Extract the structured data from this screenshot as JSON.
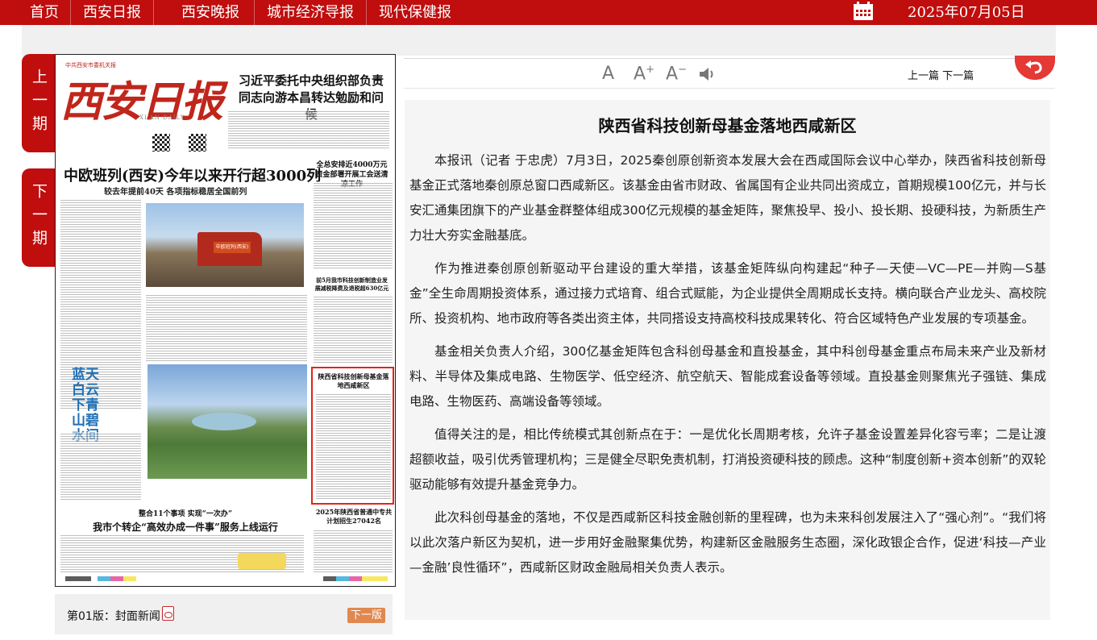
{
  "nav": {
    "items": [
      "首页",
      "西安日报",
      "西安晚报",
      "城市经济导报",
      "现代保健报"
    ],
    "date": "2025年07月05日"
  },
  "period": {
    "prev_label": "上一期",
    "next_label": "下一期"
  },
  "paper_thumb": {
    "top_line": "中共西安市委机关报",
    "logo": "西安日报",
    "logo_sub": "XI'AN DAILY",
    "headline_1": "习近平委托中央组织部负责同志向游本昌转达勉励和问候",
    "headline_main": "中欧班列(西安)今年以来开行超3000列",
    "subhead_main": "较去年提前40天 各项指标稳居全国前列",
    "train_tag": "中欧班列(西安)",
    "right_head_1": "全总安排近4000万元资金部署开展工会送清凉工作",
    "right_head_2": "前5月我市科技创新制造业发展减税降费及退税超630亿元",
    "vertical_title": "蓝天白云下青山碧水间",
    "highlight_title": "陕西省科技创新母基金落地西咸新区",
    "bottom_kicker": "整合11个事项 实现“一次办”",
    "bottom_headline": "我市个转企“高效办成一件事”服务上线运行",
    "bottom_right_head": "2025年陕西省普通中专共计划招生27042名"
  },
  "page_label": "第01版：封面新闻",
  "page_next": "下一版",
  "tools": {
    "font_normal": "A",
    "font_larger": "A",
    "font_smaller": "A",
    "prev_next": "上一篇 下一篇"
  },
  "article": {
    "title": "陕西省科技创新母基金落地西咸新区",
    "paragraphs": [
      "本报讯（记者 于忠虎）7月3日，2025秦创原创新资本发展大会在西咸国际会议中心举办，陕西省科技创新母基金正式落地秦创原总窗口西咸新区。该基金由省市财政、省属国有企业共同出资成立，首期规模100亿元，并与长安汇通集团旗下的产业基金群整体组成300亿元规模的基金矩阵，聚焦投早、投小、投长期、投硬科技，为新质生产力壮大夯实金融基底。",
      "作为推进秦创原创新驱动平台建设的重大举措，该基金矩阵纵向构建起“种子—天使—VC—PE—并购—S基金”全生命周期投资体系，通过接力式培育、组合式赋能，为企业提供全周期成长支持。横向联合产业龙头、高校院所、投资机构、地市政府等各类出资主体，共同搭设支持高校科技成果转化、符合区域特色产业发展的专项基金。",
      "基金相关负责人介绍，300亿基金矩阵包含科创母基金和直投基金，其中科创母基金重点布局未来产业及新材料、半导体及集成电路、生物医学、低空经济、航空航天、智能成套设备等领域。直投基金则聚焦光子强链、集成电路、生物医药、高端设备等领域。",
      "值得关注的是，相比传统模式其创新点在于：一是优化长周期考核，允许子基金设置差异化容亏率；二是让渡超额收益，吸引优秀管理机构；三是健全尽职免责机制，打消投资硬科技的顾虑。这种“制度创新+资本创新”的双轮驱动能够有效提升基金竞争力。",
      "此次科创母基金的落地，不仅是西咸新区科技金融创新的里程碑，也为未来科创发展注入了“强心剂”。“我们将以此次落户新区为契机，进一步用好金融聚集优势，构建新区金融服务生态圈，深化政银企合作，促进‘科技—产业—金融’良性循环”，西咸新区财政金融局相关负责人表示。"
    ]
  },
  "colors": {
    "brand_red": "#c00d0d",
    "accent_orange": "#e0884f",
    "back_red": "#e53935"
  },
  "icons": {
    "calendar": "calendar-icon",
    "pdf": "pdf-icon",
    "speaker": "speaker-icon",
    "back": "back-icon"
  }
}
